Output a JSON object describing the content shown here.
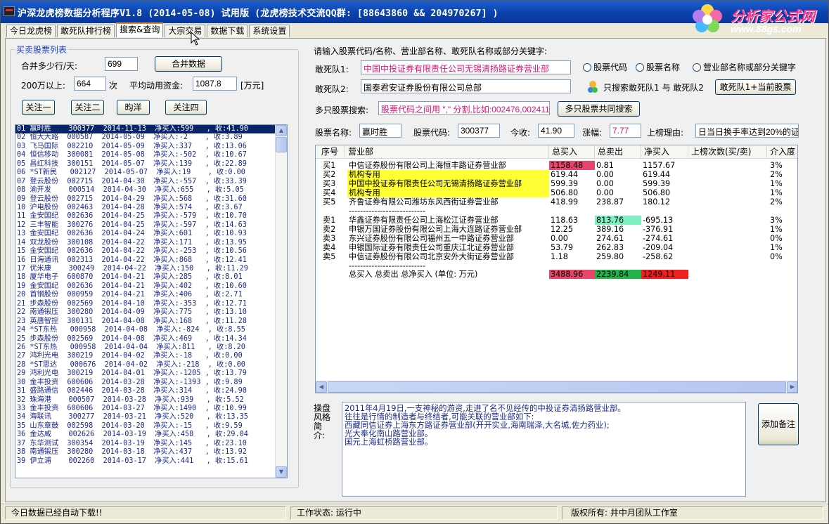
{
  "window": {
    "title": "沪深龙虎榜数据分析程序V1.8 (2014-05-08)  试用版 (龙虎榜技术交流QQ群: [88643860 && 204970267] )"
  },
  "logo": {
    "name": "分析家公式网",
    "url": "www.88gs.com"
  },
  "tabs": [
    "今日龙虎榜",
    "敢死队排行榜",
    "搜索&查询",
    "大宗交易",
    "数据下载",
    "系统设置"
  ],
  "active_tab": 2,
  "left": {
    "group_title": "买卖股票列表",
    "merge_label": "合并多少行/天:",
    "merge_value": "699",
    "merge_button": "合并数据",
    "over200_label": "200万以上:",
    "over200_value": "664",
    "over200_unit": "次",
    "avg_label": "平均动用资金:",
    "avg_value": "1087.8",
    "avg_unit": "[万元]",
    "buttons": [
      "关注一",
      "关注二",
      "昀洋",
      "关注四"
    ],
    "rows": [
      "01 赢时胜    300377  2014-11-13  净买入:599   , 收:41.90",
      "02 恒大大路  000587  2014-05-09  净买入:-2    , 收:3.89",
      "03 飞马国际  002210  2014-05-09  净买入:337   , 收:13.06",
      "04 恒信移动  300081  2014-05-08  净买入:-502  , 收:10.67",
      "05 昌红科技  300151  2014-05-07  净买入:139   , 收:22.89",
      "06 *ST新民   002127  2014-05-07  净买入:19    , 收:0.00",
      "07 登云股份  002715  2014-04-30  净买入:-557  , 收:33.39",
      "08 渝开发    000514  2014-04-30  净买入:655   , 收:5.05",
      "09 登云股份  002715  2014-04-29  净买入:568   , 收:31.60",
      "10 沪电股份  002463  2014-04-28  净买入:574   , 收:3.67",
      "11 金安国纪  002636  2014-04-25  净买入:-579  , 收:10.70",
      "12 三丰智能  300276  2014-04-25  净买入:-597  , 收:14.63",
      "13 金安国纪  002636  2014-04-24  净买入:601   , 收:10.93",
      "14 双龙股份  300108  2014-04-22  净买入:171   , 收:13.95",
      "15 金安国纪  002636  2014-04-22  净买入:-253  , 收:10.56",
      "16 日海通讯  002313  2014-04-22  净买入:868   , 收:12.41",
      "17 优米康    300249  2014-04-22  净买入:150   , 收:11.29",
      "18 厦华电子  600870  2014-04-21  净买入:285   , 收:8.01",
      "19 金安国纪  002636  2014-04-21  净买入:402   , 收:10.60",
      "20 首钢股份  000959  2014-04-21  净买入:406   , 收:2.71",
      "21 步森股份  002569  2014-04-10  净买入:-353  , 收:12.71",
      "22 南通锻压  300280  2014-04-09  净买入:775   , 收:13.10",
      "23 英唐智控  300131  2014-04-08  净买入:168   , 收:11.28",
      "24 *ST东热   000958  2014-04-08  净买入:-824  , 收:8.55",
      "25 步森股份  002569  2014-04-08  净买入:469   , 收:14.34",
      "26 *ST东热   000958  2014-04-04  净买入:811   , 收:8.20",
      "27 鸿利光电  300219  2014-04-02  净买入:-18   , 收:0.00",
      "28 *ST思达   000676  2014-04-02  净买入:-218  , 收:0.00",
      "29 鸿利光电  300219  2014-04-01  净买入:-1205 , 收:13.79",
      "30 金丰投资  600606  2014-03-28  净买入:-1393 , 收:9.89",
      "31 盛路通信  002446  2014-03-28  净买入:314   , 收:24.90",
      "32 珠海港    000507  2014-03-28  净买入:939   , 收:5.52",
      "33 金丰投资  600606  2014-03-27  净买入:1490  , 收:10.99",
      "34 海联讯    300277  2014-03-21  净买入:520   , 收:13.35",
      "35 山东章鼓  002598  2014-03-20  净买入:-15   , 收:9.59",
      "36 金达威    002626  2014-03-19  净买入:458   , 收:29.04",
      "37 东华测试  300354  2014-03-19  净买入:145   , 收:23.10",
      "38 南通锻压  300280  2014-03-18  净买入:437   , 收:13.92",
      "39 伊立浦    002260  2014-03-17  净买入:441   , 收:15.61"
    ]
  },
  "search": {
    "prompt": "请输入股票代码/名称、营业部名称、敢死队名称或部分关键字:",
    "team1_label": "敢死队1:",
    "team1_value": "中国中投证券有限责任公司无锡清扬路证券营业部",
    "team2_label": "敢死队2:",
    "team2_value": "国泰君安证券股份有限公司总部",
    "radios": [
      "股票代码",
      "股票名称",
      "营业部名称或部分关键字"
    ],
    "only_search_label": "只搜索敢死队1 与 敢死队2",
    "btn_team_stock": "敢死队1+当前股票",
    "multi_label": "多只股票搜索:",
    "multi_placeholder": "股票代码之间用 \",\" 分割,比如:002476,002411",
    "btn_multi": "多只股票共同搜索"
  },
  "stock_info": {
    "name_label": "股票名称:",
    "name": "赢时胜",
    "code_label": "股票代码:",
    "code": "300377",
    "close_label": "今收:",
    "close": "41.90",
    "change_label": "涨幅:",
    "change": "7.77",
    "reason_label": "上榜理由:",
    "reason": "日当日换手率达到20%的证券"
  },
  "table": {
    "columns": [
      "序号",
      "营业部",
      "总买入",
      "总卖出",
      "净买入",
      "上榜次数(买/卖)",
      "介入度"
    ],
    "rows": [
      {
        "id": "买1",
        "dept": "中信证券股份有限公司上海恒丰路证券营业部",
        "buy": "1158.48",
        "sell": "0.81",
        "net": "1157.67",
        "times": "",
        "pct": "3%",
        "buy_hl": "#e8456b",
        "sell_hl": "",
        "dept_hl": ""
      },
      {
        "id": "买2",
        "dept": "机构专用",
        "buy": "619.44",
        "sell": "0.00",
        "net": "619.44",
        "times": "",
        "pct": "2%",
        "buy_hl": "",
        "sell_hl": "",
        "dept_hl": "#ffff33"
      },
      {
        "id": "买3",
        "dept": "中国中投证券有限责任公司无锡清扬路证券营业部",
        "buy": "599.39",
        "sell": "0.00",
        "net": "599.39",
        "times": "",
        "pct": "1%",
        "buy_hl": "",
        "sell_hl": "",
        "dept_hl": "#ffff33"
      },
      {
        "id": "买4",
        "dept": "机构专用",
        "buy": "506.80",
        "sell": "0.00",
        "net": "506.80",
        "times": "",
        "pct": "1%",
        "buy_hl": "",
        "sell_hl": "",
        "dept_hl": "#ffff33"
      },
      {
        "id": "买5",
        "dept": "齐鲁证券有限公司潍坊东风西街证券营业部",
        "buy": "418.99",
        "sell": "238.87",
        "net": "180.12",
        "times": "",
        "pct": "2%",
        "buy_hl": "",
        "sell_hl": "",
        "dept_hl": ""
      },
      {
        "id": "",
        "dept": "---------------------------",
        "buy": "",
        "sell": "",
        "net": "",
        "times": "",
        "pct": "",
        "buy_hl": "",
        "sell_hl": "",
        "dept_hl": ""
      },
      {
        "id": "卖1",
        "dept": "华鑫证券有限责任公司上海松江证券营业部",
        "buy": "118.63",
        "sell": "813.76",
        "net": "-695.13",
        "times": "",
        "pct": "3%",
        "buy_hl": "",
        "sell_hl": "#7ff0c0",
        "dept_hl": ""
      },
      {
        "id": "卖2",
        "dept": "申银万国证券股份有限公司上海大连路证券营业部",
        "buy": "12.25",
        "sell": "389.16",
        "net": "-376.91",
        "times": "",
        "pct": "1%",
        "buy_hl": "",
        "sell_hl": "",
        "dept_hl": ""
      },
      {
        "id": "卖3",
        "dept": "东兴证券股份有限公司福州五一中路证券营业部",
        "buy": "0.00",
        "sell": "274.61",
        "net": "-274.61",
        "times": "",
        "pct": "0%",
        "buy_hl": "",
        "sell_hl": "",
        "dept_hl": ""
      },
      {
        "id": "卖4",
        "dept": "申银国际证券有限责任公司重庆江北证券营业部",
        "buy": "53.79",
        "sell": "262.83",
        "net": "-209.04",
        "times": "",
        "pct": "1%",
        "buy_hl": "",
        "sell_hl": "",
        "dept_hl": ""
      },
      {
        "id": "卖5",
        "dept": "中信证券股份有限公司北京安外大街证券营业部",
        "buy": "1.18",
        "sell": "259.80",
        "net": "-258.62",
        "times": "",
        "pct": "0%",
        "buy_hl": "",
        "sell_hl": "",
        "dept_hl": ""
      },
      {
        "id": "",
        "dept": "---------------------------",
        "buy": "",
        "sell": "",
        "net": "",
        "times": "",
        "pct": "",
        "buy_hl": "",
        "sell_hl": "",
        "dept_hl": ""
      }
    ],
    "totals_label": "总买入  总卖出  总净买入 (单位: 万元)",
    "total_buy": "3488.96",
    "total_sell": "2239.84",
    "total_net": "1249.11"
  },
  "notes": {
    "label": "操盘风格简介:",
    "lines": [
      "2011年4月19日,一支神秘的游资,走进了名不见经传的中投证券清扬路营业部。",
      "往往是行情的制造者与终结者,可能关联的营业部如下:",
      "西藏同信证券上海东方路证券营业部(开开实业,海南瑞泽,大名城,佐力药业);",
      "光大奉化南山路营业部。",
      "国元上海虹桥路营业部。"
    ],
    "add_button": "添加备注"
  },
  "status": {
    "left": "今日数据已经自动下载!!",
    "state_label": "工作状态:",
    "state": "运行中",
    "copyright_label": "版权所有:",
    "copyright": "井中月团队工作室"
  }
}
